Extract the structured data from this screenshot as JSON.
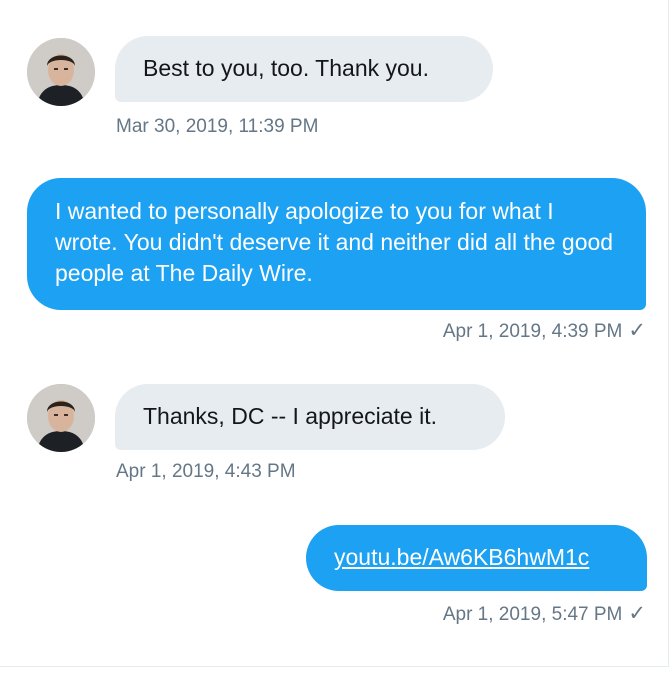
{
  "conversation": {
    "messages": [
      {
        "direction": "incoming",
        "text": "Best to you, too. Thank you.",
        "timestamp": "Mar 30, 2019, 11:39 PM"
      },
      {
        "direction": "outgoing",
        "text": "I wanted to personally apologize to you for what I wrote. You didn't deserve it and neither did all the good people at The Daily Wire.",
        "timestamp": "Apr 1, 2019, 4:39 PM",
        "read_check": "✓"
      },
      {
        "direction": "incoming",
        "text": "Thanks, DC -- I appreciate it.",
        "timestamp": "Apr 1, 2019, 4:43 PM"
      },
      {
        "direction": "outgoing",
        "text": "youtu.be/Aw6KB6hwM1c",
        "timestamp": "Apr 1, 2019, 5:47 PM",
        "read_check": "✓",
        "is_link": true
      }
    ]
  },
  "colors": {
    "outgoing_bubble": "#1da1f2",
    "incoming_bubble": "#e6ecf0",
    "timestamp": "#657786"
  },
  "icons": {
    "avatar": "user-avatar-photo",
    "read_check": "checkmark-icon"
  }
}
